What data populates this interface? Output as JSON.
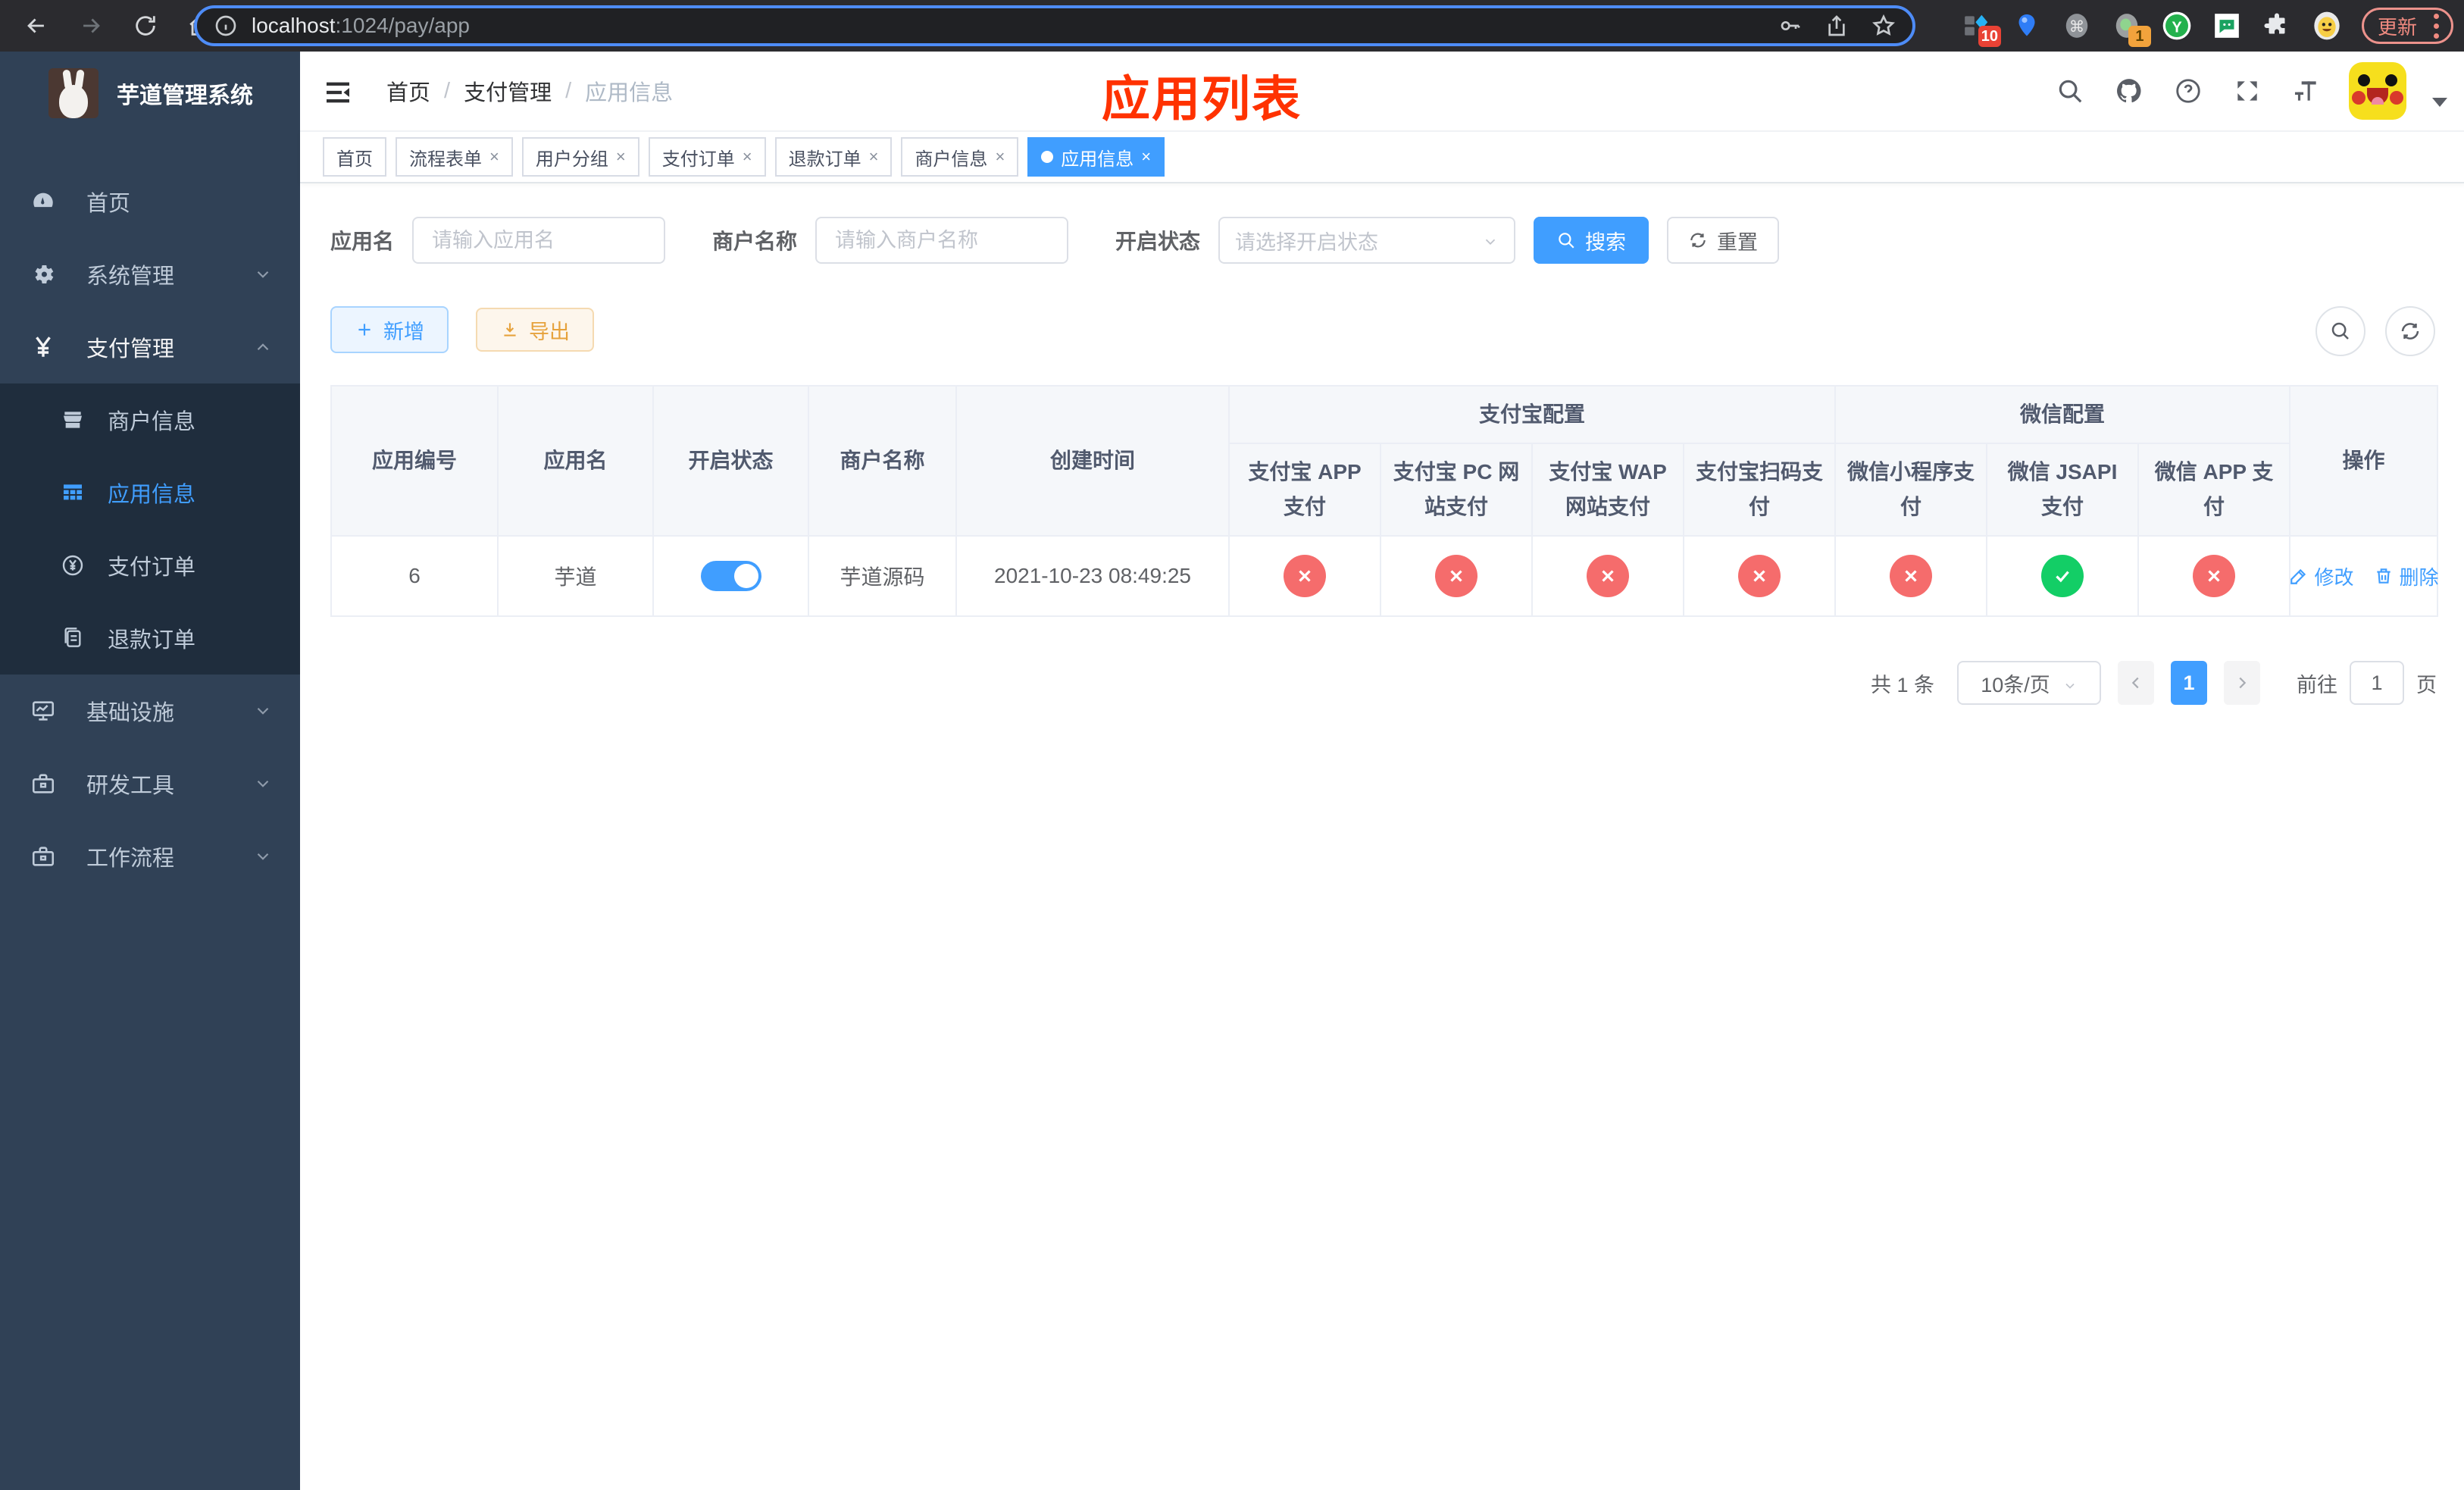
{
  "browser": {
    "url_host": "localhost",
    "url_path": ":1024/pay/app",
    "update_label": "更新",
    "extension_badges": {
      "diamond": "10",
      "profile": "1"
    }
  },
  "sidebar": {
    "title": "芋道管理系统",
    "items": [
      {
        "label": "首页",
        "icon": "dashboard-icon",
        "expandable": false
      },
      {
        "label": "系统管理",
        "icon": "gear-icon",
        "expandable": true,
        "state": "collapsed"
      },
      {
        "label": "支付管理",
        "icon": "yen-icon",
        "expandable": true,
        "state": "expanded"
      },
      {
        "label": "基础设施",
        "icon": "monitor-icon",
        "expandable": true,
        "state": "collapsed"
      },
      {
        "label": "研发工具",
        "icon": "toolbox-icon",
        "expandable": true,
        "state": "collapsed"
      },
      {
        "label": "工作流程",
        "icon": "toolbox-icon",
        "expandable": true,
        "state": "collapsed"
      }
    ],
    "submenu": [
      {
        "label": "商户信息",
        "icon": "store-icon",
        "active": false
      },
      {
        "label": "应用信息",
        "icon": "grid-icon",
        "active": true
      },
      {
        "label": "支付订单",
        "icon": "yen-circle-icon",
        "active": false
      },
      {
        "label": "退款订单",
        "icon": "documents-icon",
        "active": false
      }
    ]
  },
  "header": {
    "breadcrumb": {
      "home": "首页",
      "section": "支付管理",
      "current": "应用信息"
    },
    "annotation": "应用列表"
  },
  "tabs": [
    {
      "label": "首页",
      "closable": false,
      "active": false
    },
    {
      "label": "流程表单",
      "closable": true,
      "active": false
    },
    {
      "label": "用户分组",
      "closable": true,
      "active": false
    },
    {
      "label": "支付订单",
      "closable": true,
      "active": false
    },
    {
      "label": "退款订单",
      "closable": true,
      "active": false
    },
    {
      "label": "商户信息",
      "closable": true,
      "active": false
    },
    {
      "label": "应用信息",
      "closable": true,
      "active": true
    }
  ],
  "filters": {
    "app_name_label": "应用名",
    "app_name_placeholder": "请输入应用名",
    "app_name_value": "",
    "merchant_label": "商户名称",
    "merchant_placeholder": "请输入商户名称",
    "merchant_value": "",
    "status_label": "开启状态",
    "status_placeholder": "请选择开启状态",
    "search_label": "搜索",
    "reset_label": "重置"
  },
  "toolbar": {
    "add_label": "新增",
    "export_label": "导出"
  },
  "table": {
    "columns": [
      "应用编号",
      "应用名",
      "开启状态",
      "商户名称",
      "创建时间"
    ],
    "group_alipay": "支付宝配置",
    "group_wechat": "微信配置",
    "alipay_columns": [
      "支付宝 APP 支付",
      "支付宝 PC 网站支付",
      "支付宝 WAP 网站支付",
      "支付宝扫码支付"
    ],
    "wechat_columns": [
      "微信小程序支付",
      "微信 JSAPI 支付",
      "微信 APP 支付"
    ],
    "actions_column": "操作",
    "rows": [
      {
        "app_id": "6",
        "app_name": "芋道",
        "enabled": true,
        "merchant": "芋道源码",
        "created_at": "2021-10-23 08:49:25",
        "channel_status": [
          "no",
          "no",
          "no",
          "no",
          "no",
          "yes",
          "no"
        ],
        "edit_label": "修改",
        "delete_label": "删除"
      }
    ]
  },
  "pagination": {
    "total_text": "共 1 条",
    "page_size": "10条/页",
    "current_page": "1",
    "goto_prefix": "前往",
    "goto_value": "1",
    "goto_suffix": "页"
  }
}
